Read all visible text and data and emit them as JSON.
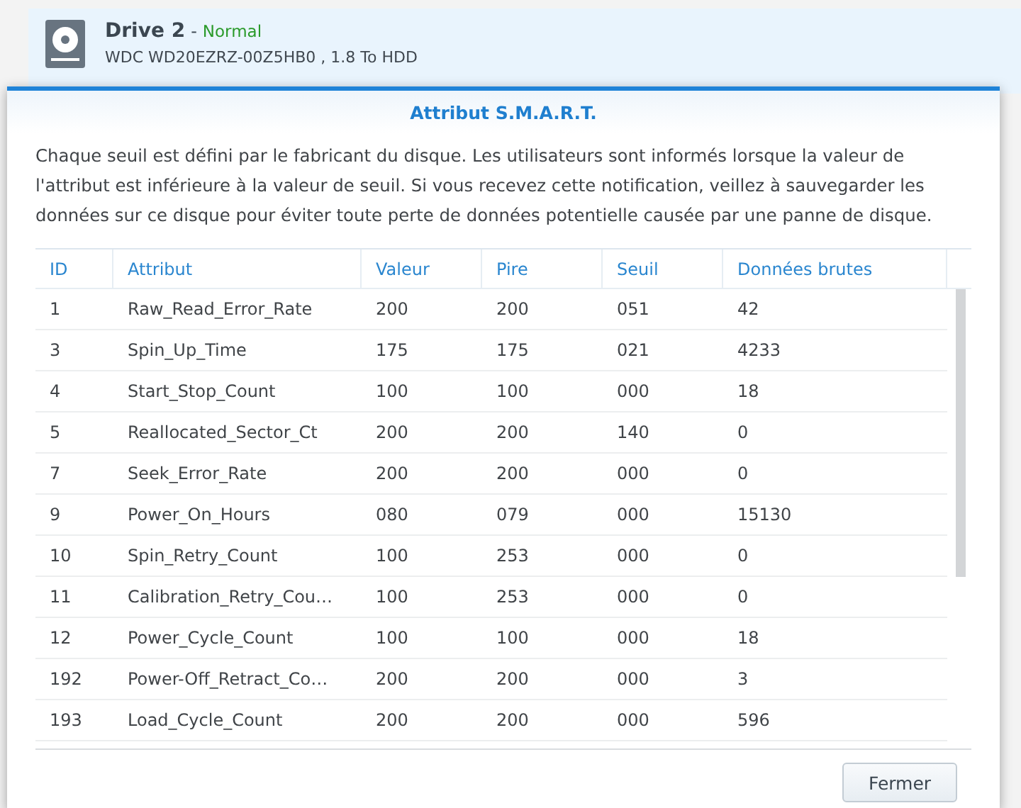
{
  "drive": {
    "name": "Drive 2",
    "separator": "-",
    "status": "Normal",
    "model": "WDC WD20EZRZ-00Z5HB0 , 1.8 To HDD"
  },
  "dialog": {
    "title": "Attribut S.M.A.R.T.",
    "description": "Chaque seuil est défini par le fabricant du disque. Les utilisateurs sont informés lorsque la valeur de l'attribut est inférieure à la valeur de seuil. Si vous recevez cette notification, veillez à sauvegarder les données sur ce disque pour éviter toute perte de données potentielle causée par une panne de disque.",
    "table": {
      "columns": [
        "ID",
        "Attribut",
        "Valeur",
        "Pire",
        "Seuil",
        "Données brutes"
      ],
      "rows": [
        [
          "1",
          "Raw_Read_Error_Rate",
          "200",
          "200",
          "051",
          "42"
        ],
        [
          "3",
          "Spin_Up_Time",
          "175",
          "175",
          "021",
          "4233"
        ],
        [
          "4",
          "Start_Stop_Count",
          "100",
          "100",
          "000",
          "18"
        ],
        [
          "5",
          "Reallocated_Sector_Ct",
          "200",
          "200",
          "140",
          "0"
        ],
        [
          "7",
          "Seek_Error_Rate",
          "200",
          "200",
          "000",
          "0"
        ],
        [
          "9",
          "Power_On_Hours",
          "080",
          "079",
          "000",
          "15130"
        ],
        [
          "10",
          "Spin_Retry_Count",
          "100",
          "253",
          "000",
          "0"
        ],
        [
          "11",
          "Calibration_Retry_Cou…",
          "100",
          "253",
          "000",
          "0"
        ],
        [
          "12",
          "Power_Cycle_Count",
          "100",
          "100",
          "000",
          "18"
        ],
        [
          "192",
          "Power-Off_Retract_Co…",
          "200",
          "200",
          "000",
          "3"
        ],
        [
          "193",
          "Load_Cycle_Count",
          "200",
          "200",
          "000",
          "596"
        ]
      ]
    },
    "buttons": [
      "Fermer"
    ]
  }
}
